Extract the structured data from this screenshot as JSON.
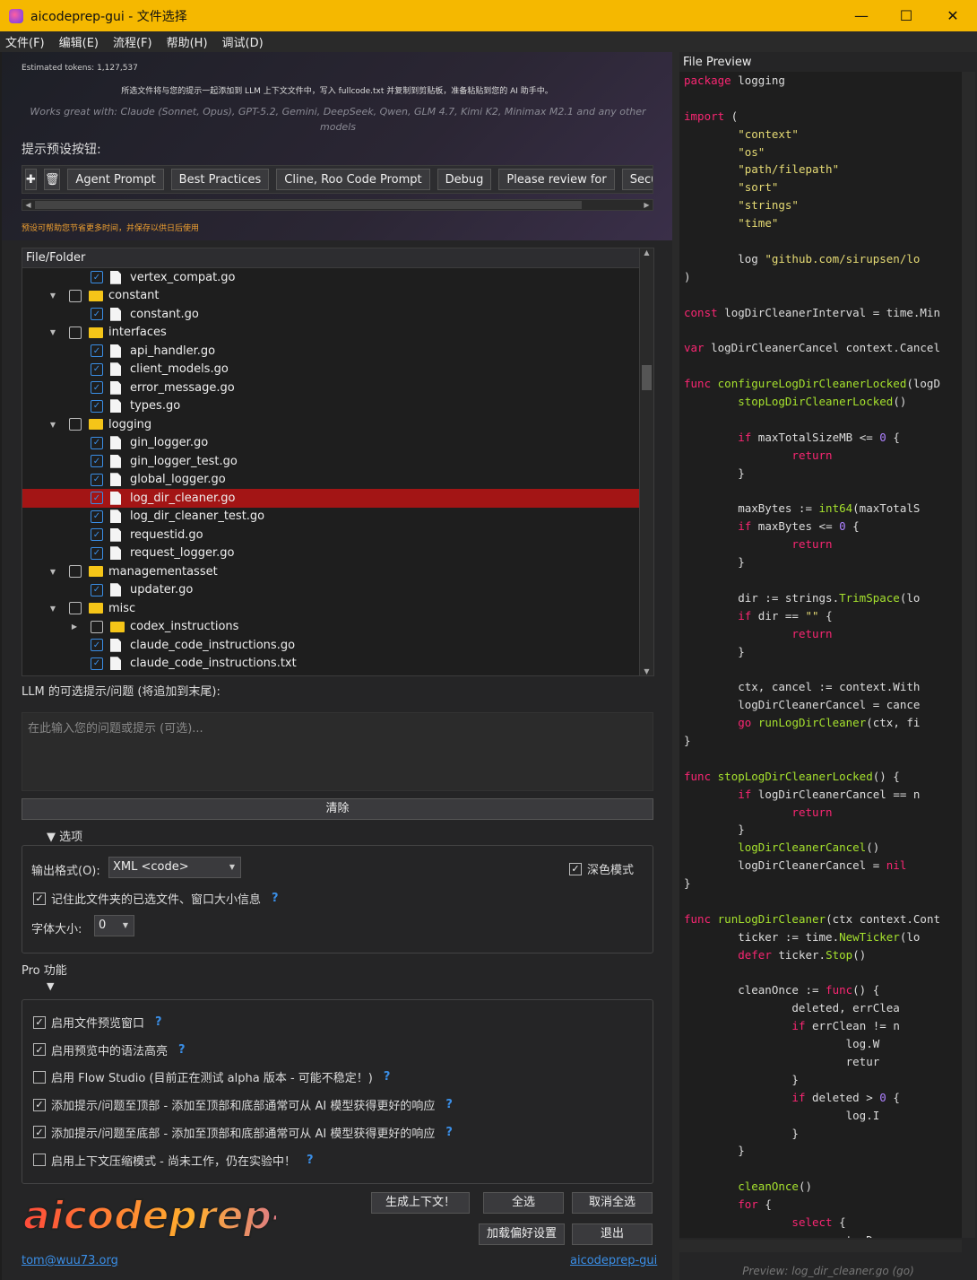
{
  "window": {
    "title": "aicodeprep-gui - 文件选择"
  },
  "menu": [
    "文件(F)",
    "编辑(E)",
    "流程(F)",
    "帮助(H)",
    "调试(D)"
  ],
  "header": {
    "tokens": "Estimated tokens: 1,127,537",
    "info": "所选文件将与您的提示一起添加到 LLM 上下文文件中，写入 fullcode.txt 并复制到剪贴板，准备粘贴到您的 AI 助手中。",
    "works_with": "Works great with: Claude (Sonnet, Opus), GPT-5.2, Gemini, DeepSeek, Qwen, GLM 4.7, Kimi K2, Minimax M2.1 and any other models"
  },
  "presets": {
    "label": "提示预设按钮:",
    "add_icon": "plus-icon",
    "delete_icon": "trash-icon",
    "buttons": [
      "Agent Prompt",
      "Best Practices",
      "Cline, Roo Code Prompt",
      "Debug",
      "Please review for",
      "Secu"
    ],
    "hint": "预设可帮助您节省更多时间，并保存以供日后使用"
  },
  "tree": {
    "header": "File/Folder",
    "rows": [
      {
        "name": "vertex_compat.go",
        "type": "file",
        "level": 2,
        "checked": true
      },
      {
        "name": "constant",
        "type": "dir",
        "level": 1,
        "checked": false,
        "expanded": true
      },
      {
        "name": "constant.go",
        "type": "file",
        "level": 2,
        "checked": true
      },
      {
        "name": "interfaces",
        "type": "dir",
        "level": 1,
        "checked": false,
        "expanded": true
      },
      {
        "name": "api_handler.go",
        "type": "file",
        "level": 2,
        "checked": true
      },
      {
        "name": "client_models.go",
        "type": "file",
        "level": 2,
        "checked": true
      },
      {
        "name": "error_message.go",
        "type": "file",
        "level": 2,
        "checked": true
      },
      {
        "name": "types.go",
        "type": "file",
        "level": 2,
        "checked": true
      },
      {
        "name": "logging",
        "type": "dir",
        "level": 1,
        "checked": false,
        "expanded": true
      },
      {
        "name": "gin_logger.go",
        "type": "file",
        "level": 2,
        "checked": true
      },
      {
        "name": "gin_logger_test.go",
        "type": "file",
        "level": 2,
        "checked": true
      },
      {
        "name": "global_logger.go",
        "type": "file",
        "level": 2,
        "checked": true
      },
      {
        "name": "log_dir_cleaner.go",
        "type": "file",
        "level": 2,
        "checked": true,
        "selected": true
      },
      {
        "name": "log_dir_cleaner_test.go",
        "type": "file",
        "level": 2,
        "checked": true
      },
      {
        "name": "requestid.go",
        "type": "file",
        "level": 2,
        "checked": true
      },
      {
        "name": "request_logger.go",
        "type": "file",
        "level": 2,
        "checked": true
      },
      {
        "name": "managementasset",
        "type": "dir",
        "level": 1,
        "checked": false,
        "expanded": true
      },
      {
        "name": "updater.go",
        "type": "file",
        "level": 2,
        "checked": true
      },
      {
        "name": "misc",
        "type": "dir",
        "level": 1,
        "checked": false,
        "expanded": true
      },
      {
        "name": "codex_instructions",
        "type": "dir",
        "level": 2,
        "checked": false,
        "expanded": false
      },
      {
        "name": "claude_code_instructions.go",
        "type": "file",
        "level": 2,
        "checked": true
      },
      {
        "name": "claude_code_instructions.txt",
        "type": "file",
        "level": 2,
        "checked": true
      }
    ]
  },
  "llm": {
    "label": "LLM 的可选提示/问题 (将追加到末尾):",
    "placeholder": "在此输入您的问题或提示 (可选)...",
    "clear": "清除"
  },
  "options": {
    "toggle": "▼  选项",
    "format_label": "输出格式(O):",
    "format_value": "XML <code>",
    "dark_mode": "深色模式",
    "remember": "记住此文件夹的已选文件、窗口大小信息",
    "font_label": "字体大小:",
    "font_value": "0"
  },
  "pro": {
    "title": "Pro 功能",
    "items": [
      {
        "label": "启用文件预览窗口",
        "checked": true
      },
      {
        "label": "启用预览中的语法高亮",
        "checked": true
      },
      {
        "label": "启用 Flow Studio (目前正在测试 alpha 版本 - 可能不稳定！)",
        "checked": false
      },
      {
        "label": "添加提示/问题至顶部 - 添加至顶部和底部通常可从 AI 模型获得更好的响应",
        "checked": true
      },
      {
        "label": "添加提示/问题至底部 - 添加至顶部和底部通常可从 AI 模型获得更好的响应",
        "checked": true
      },
      {
        "label": "启用上下文压缩模式 - 尚未工作，仍在实验中！",
        "checked": false
      }
    ]
  },
  "actions": {
    "generate": "生成上下文！",
    "select_all": "全选",
    "deselect_all": "取消全选",
    "load_prefs": "加载偏好设置",
    "exit": "退出"
  },
  "footer": {
    "logo": "aicodeprep-gui",
    "email": "tom@wuu73.org",
    "site": "aicodeprep-gui"
  },
  "preview": {
    "title": "File Preview",
    "status": "Preview: log_dir_cleaner.go (go)",
    "lines": [
      "package logging",
      "",
      "import (",
      "        \"context\"",
      "        \"os\"",
      "        \"path/filepath\"",
      "        \"sort\"",
      "        \"strings\"",
      "        \"time\"",
      "",
      "        log \"github.com/sirupsen/lo",
      ")",
      "",
      "const logDirCleanerInterval = time.Min",
      "",
      "var logDirCleanerCancel context.Cancel",
      "",
      "func configureLogDirCleanerLocked(logD",
      "        stopLogDirCleanerLocked()",
      "",
      "        if maxTotalSizeMB <= 0 {",
      "                return",
      "        }",
      "",
      "        maxBytes := int64(maxTotalS",
      "        if maxBytes <= 0 {",
      "                return",
      "        }",
      "",
      "        dir := strings.TrimSpace(lo",
      "        if dir == \"\" {",
      "                return",
      "        }",
      "",
      "        ctx, cancel := context.With",
      "        logDirCleanerCancel = cance",
      "        go runLogDirCleaner(ctx, fi",
      "}",
      "",
      "func stopLogDirCleanerLocked() {",
      "        if logDirCleanerCancel == n",
      "                return",
      "        }",
      "        logDirCleanerCancel()",
      "        logDirCleanerCancel = nil",
      "}",
      "",
      "func runLogDirCleaner(ctx context.Cont",
      "        ticker := time.NewTicker(lo",
      "        defer ticker.Stop()",
      "",
      "        cleanOnce := func() {",
      "                deleted, errClea",
      "                if errClean != n",
      "                        log.W",
      "                        retur",
      "                }",
      "                if deleted > 0 {",
      "                        log.I",
      "                }",
      "        }",
      "",
      "        cleanOnce()",
      "        for {",
      "                select {",
      "                case <-ctx.Done"
    ]
  }
}
